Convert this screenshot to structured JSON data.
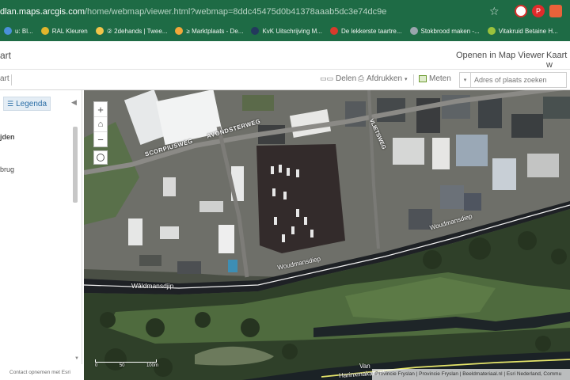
{
  "browser": {
    "url_host": "dlan.maps.arcgis.com",
    "url_path": "/home/webmap/viewer.html?webmap=8ddc45475d0b41378aaab5dc3e74dc9e",
    "bookmarks": [
      {
        "label": "u: Bl...",
        "color": "#4a90d9"
      },
      {
        "label": "RAL Kleuren",
        "color": "#e0b52c"
      },
      {
        "label": "② 2dehands | Twee...",
        "color": "#f2c54a"
      },
      {
        "label": "≥ Marktplaats - De...",
        "color": "#f3a73a"
      },
      {
        "label": "KvK Uitschrijving M...",
        "color": "#23395d"
      },
      {
        "label": "De lekkerste taartre...",
        "color": "#d83b2c"
      },
      {
        "label": "Stokbrood maken -...",
        "color": "#9aa5ad"
      },
      {
        "label": "Vitakruid Betaine H...",
        "color": "#9bc23c"
      }
    ]
  },
  "header": {
    "title": "art",
    "open_map_viewer": "Openen in Map Viewer",
    "kaart": "Kaart w"
  },
  "toolbar": {
    "left_label": "art",
    "delen": "Delen",
    "afdrukken": "Afdrukken",
    "meten": "Meten",
    "search_placeholder": "Adres of plaats zoeken"
  },
  "left_panel": {
    "legend_label": "Legenda",
    "item_1": "jden",
    "item_2": "brug",
    "footer": "Contact opnemen met Esri"
  },
  "map": {
    "labels": {
      "scorpiusweg": "SCORPIUSWEG",
      "avondsterweg": "AVONDSTERWEG",
      "vlietsweg": "VLIETSWEG",
      "woudmansdiep_east": "Woudmansdiep",
      "woudmansdiep_mid": "Woudmansdiep",
      "waldmansdjip": "Wâldmansdjip",
      "van": "Van",
      "harinxmakanaal": "Harinxmakanaal"
    },
    "scale_labels": [
      "0",
      "50",
      "100m"
    ],
    "attribution": "Provincie Fryslan | Provincie Fryslan | Beeldmateriaal.nl | Esri Nederland, Commu"
  }
}
